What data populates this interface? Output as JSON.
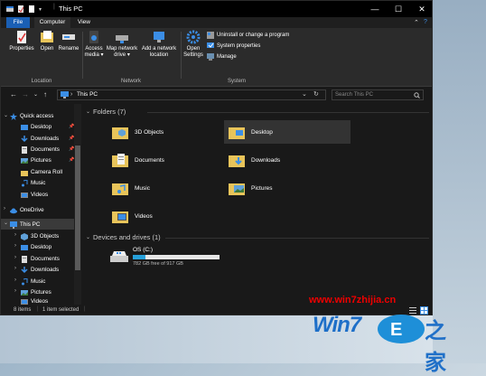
{
  "titlebar": {
    "title": "This PC",
    "qa_dropdown": "▾",
    "minimize": "—",
    "maximize": "☐",
    "close": "✕"
  },
  "tabs": {
    "file": "File",
    "computer": "Computer",
    "view": "View",
    "expand": "⌃",
    "help": "?"
  },
  "ribbon": {
    "properties": "Properties",
    "open": "Open",
    "rename": "Rename",
    "access_media": "Access\nmedia ▾",
    "map_network_drive": "Map network\ndrive ▾",
    "add_network_location": "Add a network\nlocation",
    "open_settings": "Open\nSettings",
    "uninstall": "Uninstall or change a program",
    "system_properties": "System properties",
    "manage": "Manage",
    "groups": {
      "location": "Location",
      "network": "Network",
      "system": "System"
    }
  },
  "address": {
    "back": "←",
    "forward": "→",
    "up_dropdown": "⌄",
    "up": "↑",
    "path_sep": "›",
    "path": "This PC",
    "dropdown": "⌄",
    "refresh": "↻",
    "search_placeholder": "Search This PC"
  },
  "nav": {
    "quick_access": "Quick access",
    "desktop": "Desktop",
    "downloads": "Downloads",
    "documents": "Documents",
    "pictures": "Pictures",
    "camera_roll": "Camera Roll",
    "videos": "Videos",
    "onedrive": "OneDrive",
    "this_pc": "This PC",
    "objects3d": "3D Objects",
    "desktop2": "Desktop",
    "documents2": "Documents",
    "downloads2": "Downloads",
    "music": "Music",
    "pictures2": "Pictures",
    "videos2": "Videos"
  },
  "content": {
    "folders_header": "Folders (7)",
    "devices_header": "Devices and drives (1)",
    "folders": [
      "3D Objects",
      "Desktop",
      "Documents",
      "Downloads",
      "Music",
      "Pictures",
      "Videos"
    ],
    "drive": {
      "name": "OS (C:)",
      "free": "782 GB free of 917 GB",
      "used_fraction": 0.147
    }
  },
  "status": {
    "items": "8 items",
    "selected": "1 item selected"
  },
  "watermark": {
    "text": "www.win7zhijia.cn",
    "logo": "Win7",
    "logo_cn": "之家"
  },
  "colors": {
    "accent": "#1a5fb4",
    "drive_bar": "#26a0da",
    "folder": "#e8c45a"
  }
}
